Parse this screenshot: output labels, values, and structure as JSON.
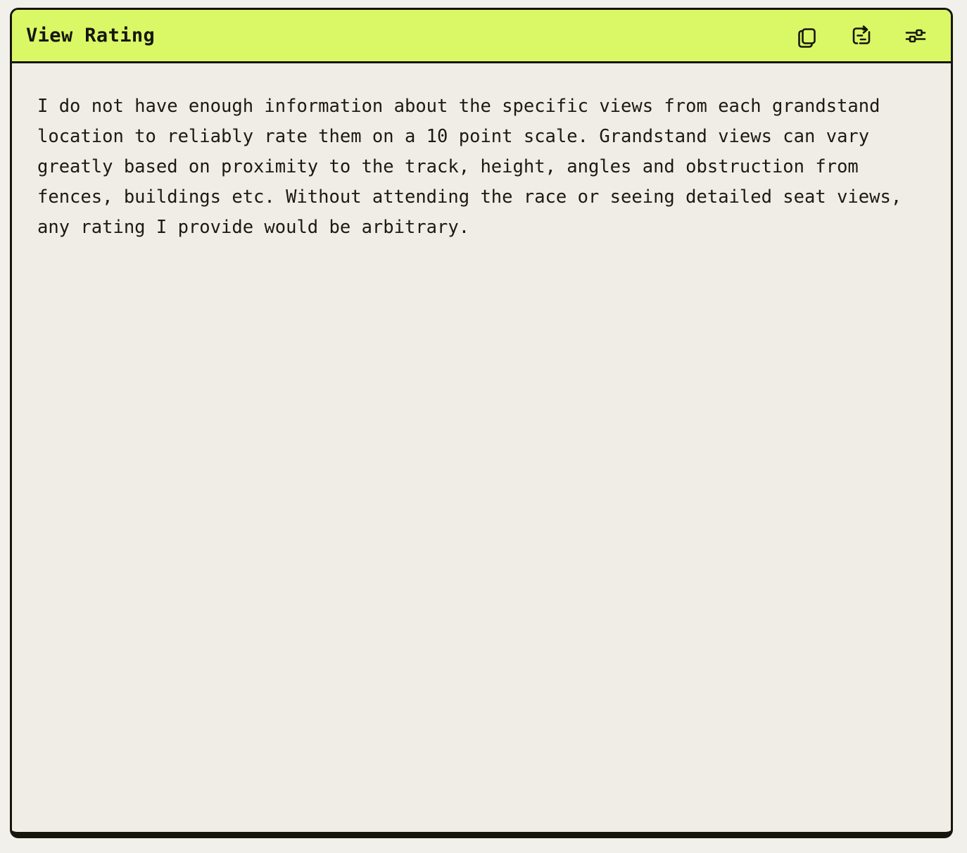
{
  "window": {
    "title": "View Rating",
    "header_bg": "#daf866",
    "body_bg": "#f0ede6",
    "border_color": "#16160f",
    "text_color": "#1a1a16"
  },
  "title_bar": {
    "actions": [
      {
        "name": "copy-icon",
        "label": "Copy"
      },
      {
        "name": "export-icon",
        "label": "Export"
      },
      {
        "name": "settings-icon",
        "label": "Settings"
      }
    ]
  },
  "content": {
    "response_text": "I do not have enough information about the specific views from each grandstand location to reliably rate them on a 10 point scale. Grandstand views can vary greatly based on proximity to the track, height, angles and obstruction from fences, buildings etc. Without attending the race or seeing detailed seat views, any rating I provide would be arbitrary."
  }
}
